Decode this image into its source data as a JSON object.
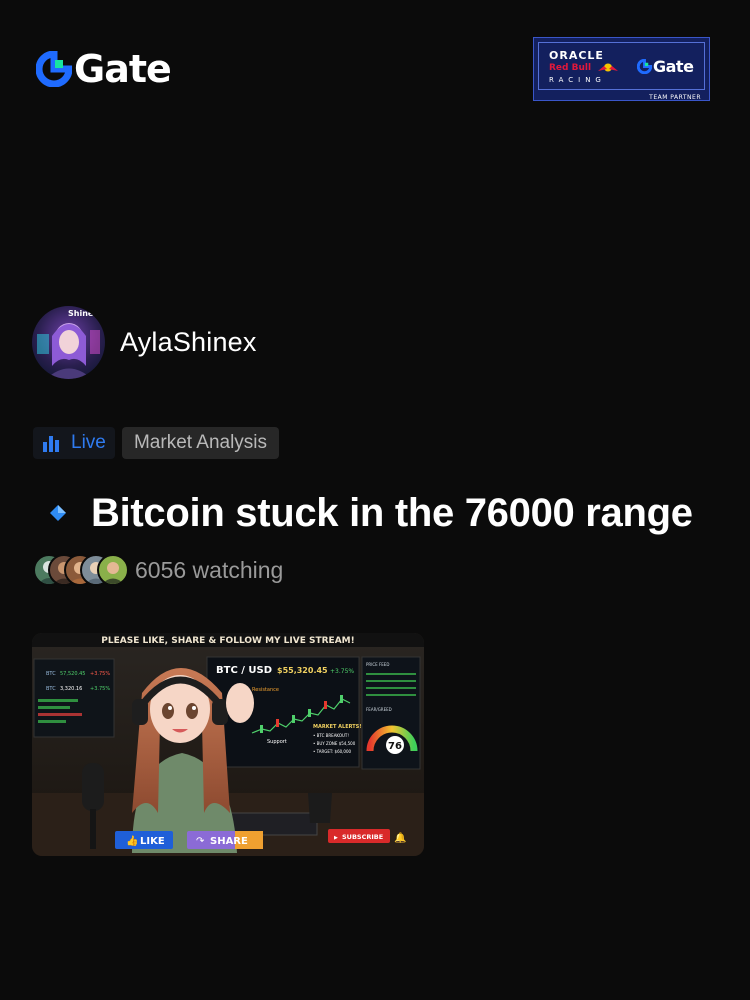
{
  "header": {
    "logo_text": "Gate",
    "logo_icon": "gate-logo-mark",
    "partner_badge": {
      "line1": "ORACLE",
      "line2": "Red Bull",
      "line3": "RACING",
      "brand": "Gate",
      "footer": "TEAM PARTNER"
    }
  },
  "profile": {
    "avatar_overlay": "Shinex",
    "username": "AylaShinex"
  },
  "tags": {
    "live_label": "Live",
    "category_label": "Market Analysis"
  },
  "stream": {
    "title": "Bitcoin stuck in the 76000 range",
    "watching": "6056 watching"
  },
  "thumbnail": {
    "banner": "PLEASE LIKE, SHARE & FOLLOW MY LIVE STREAM!",
    "pair": "BTC / USD",
    "price": "$55,320.45",
    "change": "+3.75%",
    "resistance": "Resistance",
    "support": "Support",
    "alerts_title": "MARKET ALERTS!",
    "alert_1": "• BTC BREAKOUT!",
    "alert_2": "• BUY ZONE $54,500",
    "alert_3": "• TARGET: $60,000",
    "ticker_1_name": "BTC",
    "ticker_1_price": "57,520.45",
    "ticker_1_change": "+3.75%",
    "ticker_2_name": "BTC",
    "ticker_2_price": "3,320.16",
    "ticker_2_change": "+3.75%",
    "gauge_value": "76",
    "panel_title_1": "PRICE FEED",
    "panel_title_2": "FEAR/GREED",
    "like_label": "LIKE",
    "share_label": "SHARE",
    "subscribe_label": "SUBSCRIBE"
  },
  "colors": {
    "background": "#0b0b0b",
    "accent_blue": "#2f7bf0",
    "logo_blue": "#1f6bff",
    "logo_green": "#17e5a0",
    "muted_text": "#9a9a9a",
    "tag_bg": "#272727"
  }
}
